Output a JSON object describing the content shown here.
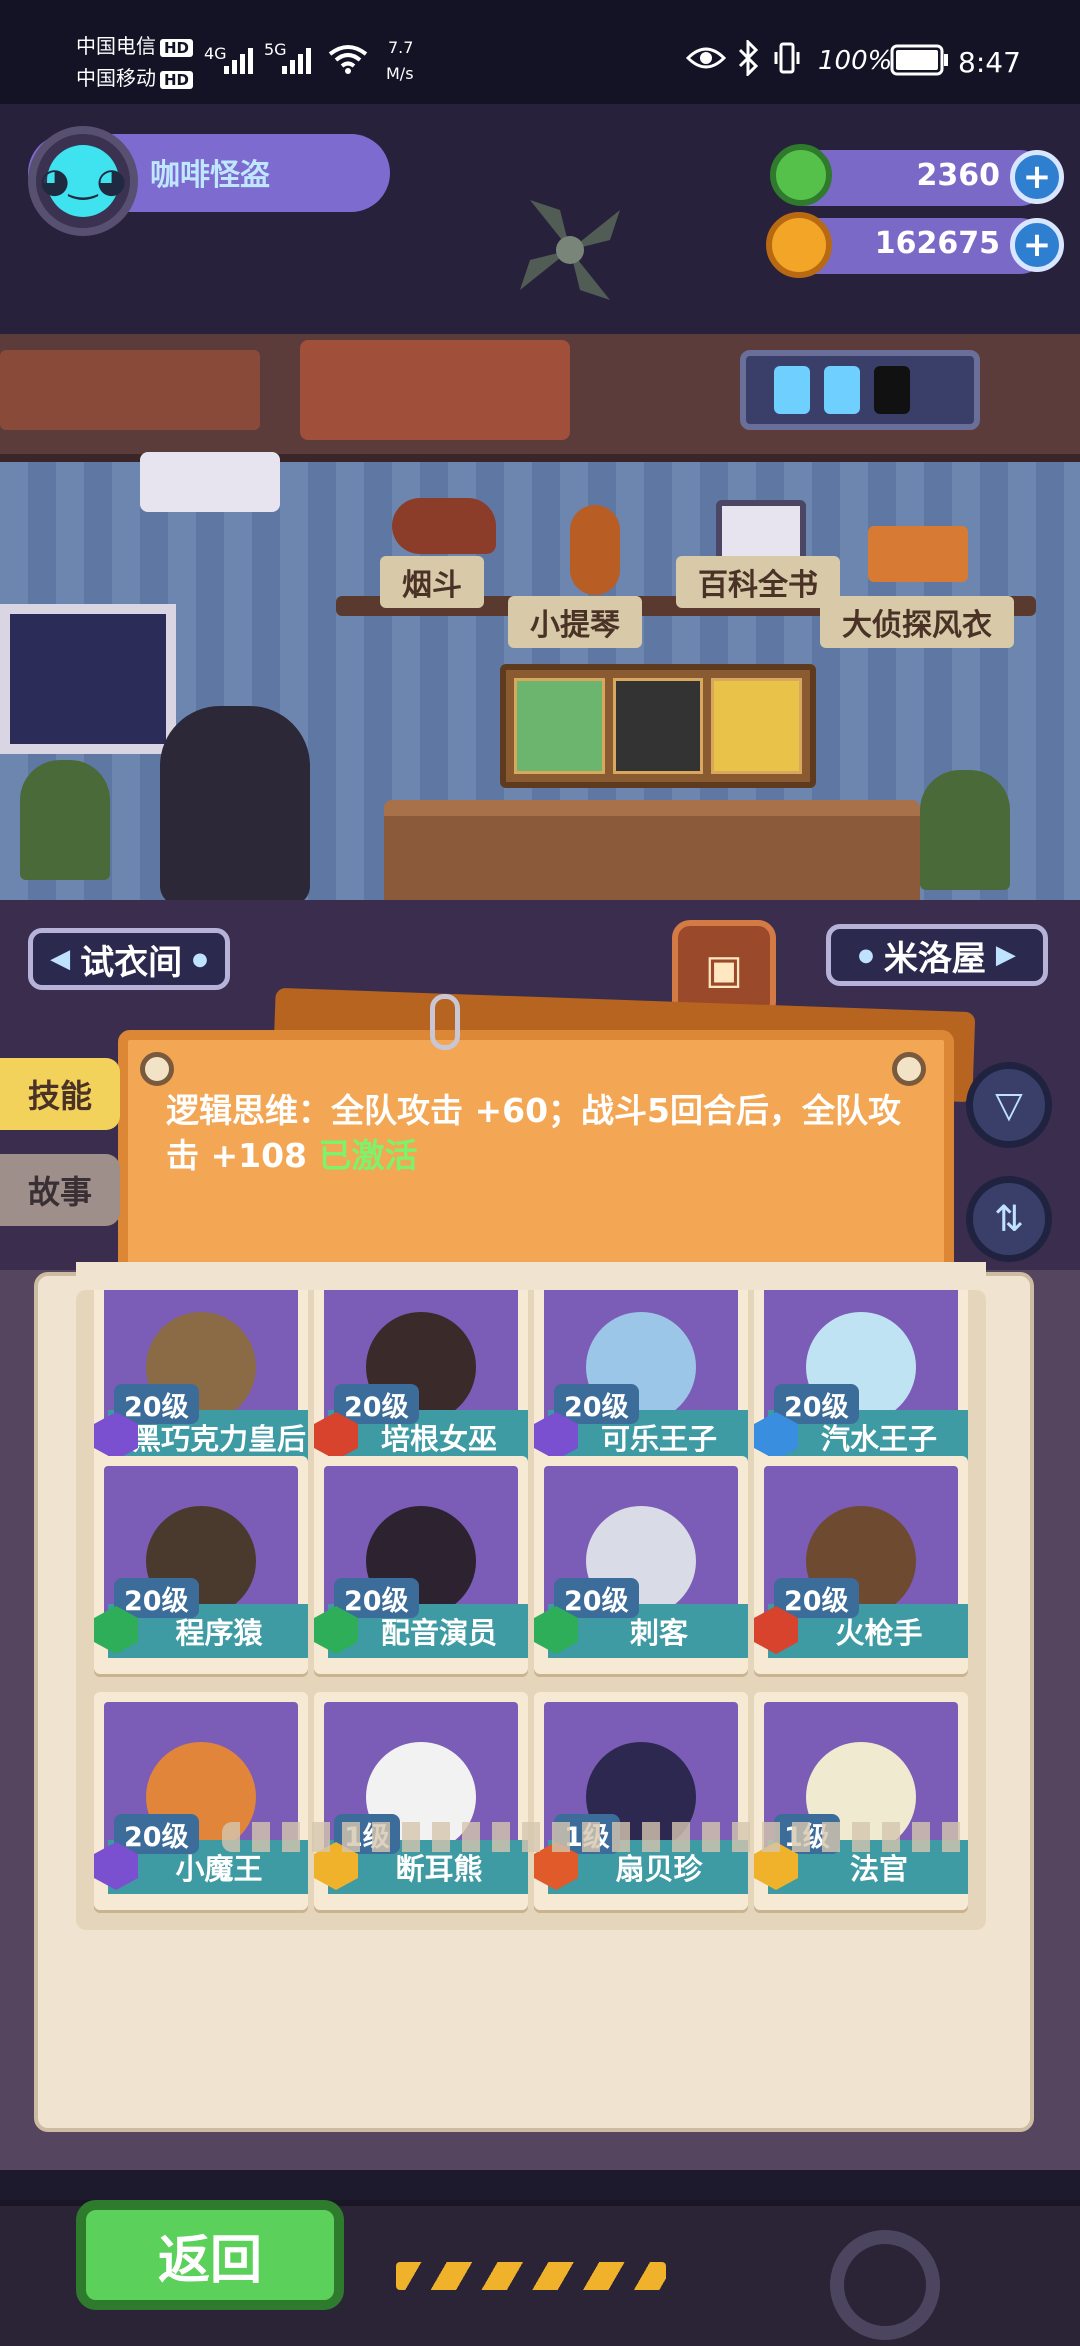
{
  "status_bar": {
    "carrier_1": "中国电信",
    "carrier_2": "中国移动",
    "hd": "HD",
    "net_1": "4G",
    "net_2": "5G",
    "speed_value": "7.7",
    "speed_unit": "M/s",
    "battery": "100%",
    "time": "8:47"
  },
  "header": {
    "username": "咖啡怪盗",
    "currency_green": "2360",
    "currency_gold": "162675",
    "plus_symbol": "+"
  },
  "shelf": {
    "items": [
      "烟斗",
      "小提琴",
      "百科全书",
      "大侦探风衣"
    ]
  },
  "nav": {
    "left_label": "试衣间",
    "right_label": "米洛屋"
  },
  "side_tabs": {
    "skill": "技能",
    "story": "故事"
  },
  "skill": {
    "text": "逻辑思维：全队攻击 +60；战斗5回合后，全队攻击 +108",
    "status": "已激活"
  },
  "cards": [
    {
      "level": "20级",
      "name": "黑巧克力皇后",
      "badge_color": "#7a4fd0",
      "pic_color": "#8a6b45"
    },
    {
      "level": "20级",
      "name": "培根女巫",
      "badge_color": "#d8432e",
      "pic_color": "#3b2a2a"
    },
    {
      "level": "20级",
      "name": "可乐王子",
      "badge_color": "#7a4fd0",
      "pic_color": "#9cc6e8"
    },
    {
      "level": "20级",
      "name": "汽水王子",
      "badge_color": "#3a8ee0",
      "pic_color": "#bfe3f2"
    },
    {
      "level": "20级",
      "name": "程序猿",
      "badge_color": "#2fae5a",
      "pic_color": "#4a3a2e"
    },
    {
      "level": "20级",
      "name": "配音演员",
      "badge_color": "#2fae5a",
      "pic_color": "#2d2230"
    },
    {
      "level": "20级",
      "name": "刺客",
      "badge_color": "#2fae5a",
      "pic_color": "#d9dbe6"
    },
    {
      "level": "20级",
      "name": "火枪手",
      "badge_color": "#d8432e",
      "pic_color": "#6e4a30"
    },
    {
      "level": "20级",
      "name": "小魔王",
      "badge_color": "#7a4fd0",
      "pic_color": "#e0853a"
    },
    {
      "level": "1级",
      "name": "断耳熊",
      "badge_color": "#f0b22a",
      "pic_color": "#f2f2f2"
    },
    {
      "level": "1级",
      "name": "扇贝珍",
      "badge_color": "#e05a2a",
      "pic_color": "#2d2850"
    },
    {
      "level": "1级",
      "name": "法官",
      "badge_color": "#f0b22a",
      "pic_color": "#f0ead0"
    }
  ],
  "footer": {
    "back_label": "返回"
  }
}
